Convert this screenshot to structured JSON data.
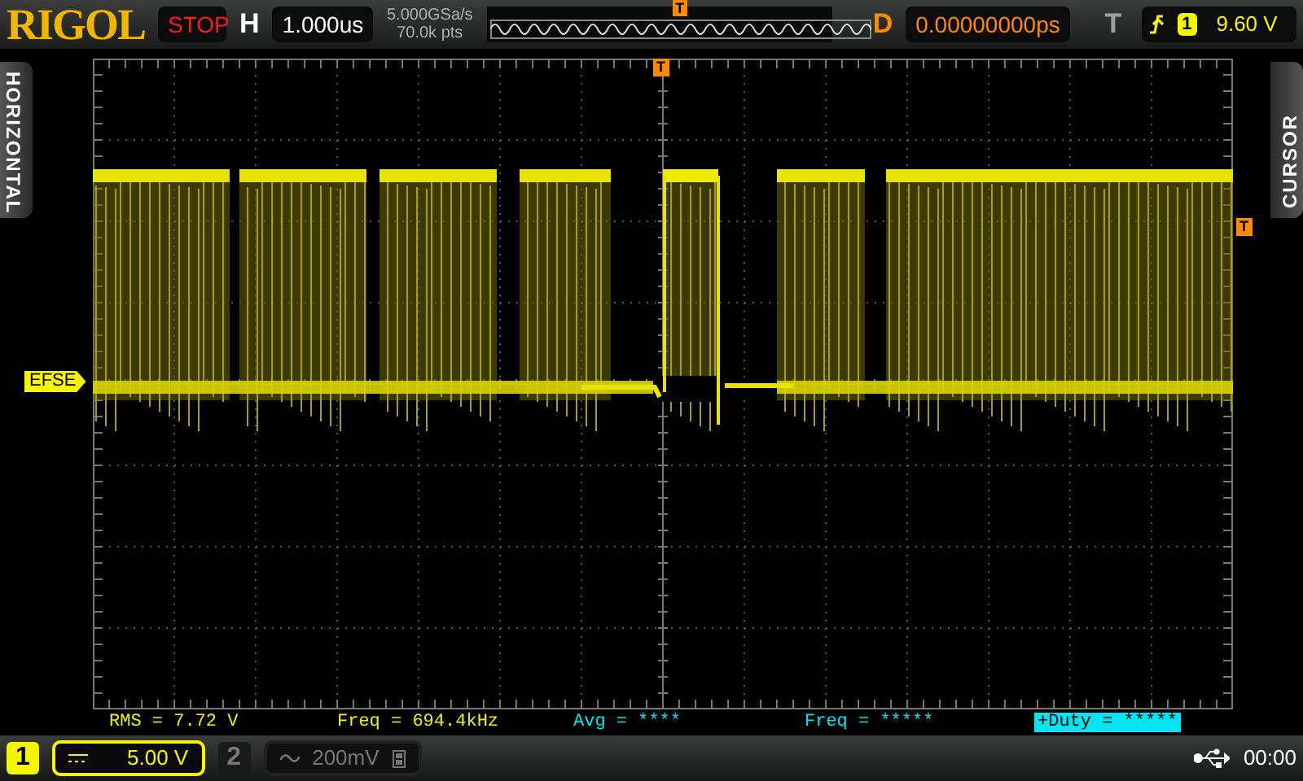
{
  "brand": "RIGOL",
  "run_state": "STOP",
  "horizontal": {
    "label": "H",
    "timebase": "1.000us",
    "sample_rate": "5.000GSa/s",
    "memory_depth": "70.0k pts"
  },
  "overview": {
    "trigger_marker": "T"
  },
  "delay": {
    "label": "D",
    "value": "0.00000000ps"
  },
  "trigger": {
    "label": "T",
    "source": "1",
    "level": "9.60 V"
  },
  "side_tabs": {
    "left": "HORIZONTAL",
    "right": "CURSOR"
  },
  "screen": {
    "trigger_position_marker": "T",
    "trigger_level_marker": "T",
    "channel_label": "EFSE"
  },
  "measurements": [
    {
      "text": "RMS = 7.72 V",
      "color": "#f0f000",
      "highlighted": false
    },
    {
      "text": "Freq = 694.4kHz",
      "color": "#f0f000",
      "highlighted": false
    },
    {
      "text": "Avg = ****",
      "color": "#00e5f0",
      "highlighted": false
    },
    {
      "text": "Freq = *****",
      "color": "#00e5f0",
      "highlighted": false
    },
    {
      "text": "+Duty = *****",
      "color": "#00e5f0",
      "highlighted": true
    }
  ],
  "channels": [
    {
      "number": "1",
      "kind": "dc",
      "scale": "5.00 V",
      "selected": true,
      "bandwidth_limit": false
    },
    {
      "number": "2",
      "kind": "ac",
      "scale": "200mV",
      "selected": false,
      "bandwidth_limit": true
    }
  ],
  "status": {
    "time": "00:00"
  }
}
